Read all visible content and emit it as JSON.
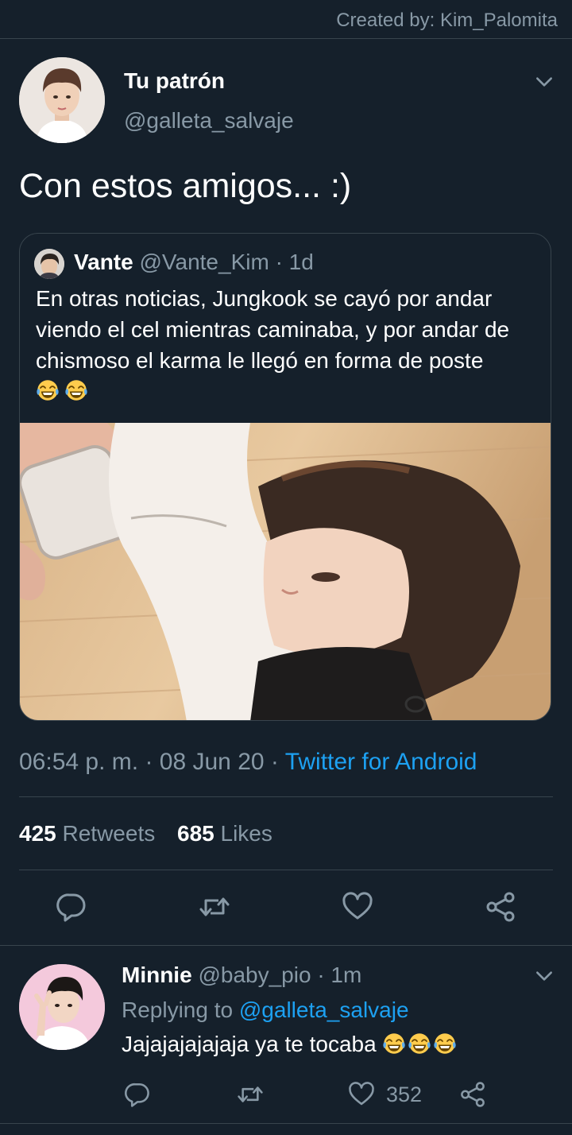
{
  "watermark": "Created by: Kim_Palomita",
  "tweet": {
    "display_name": "Tu patrón",
    "handle": "@galleta_salvaje",
    "text": "Con estos amigos... :)",
    "time": "06:54 p. m.",
    "date": "08 Jun 20",
    "sep": "·",
    "source": "Twitter for Android",
    "retweets_count": "425",
    "retweets_label": "Retweets",
    "likes_count": "685",
    "likes_label": "Likes"
  },
  "quoted": {
    "display_name": "Vante",
    "handle": "@Vante_Kim",
    "age": "· 1d",
    "text": "En otras noticias, Jungkook se cayó por andar viendo el cel mientras caminaba, y por andar de chismoso el karma le llegó en forma de poste",
    "emoji": [
      "face-with-tears-of-joy",
      "face-with-tears-of-joy"
    ]
  },
  "reply": {
    "display_name": "Minnie",
    "handle": "@baby_pio",
    "age": "· 1m",
    "replying_prefix": "Replying to",
    "replying_handle": "@galleta_salvaje",
    "text": "Jajajajajajaja ya te tocaba",
    "emoji": [
      "face-with-tears-of-joy",
      "face-with-tears-of-joy",
      "face-with-tears-of-joy"
    ],
    "likes_count": "352"
  },
  "icons": [
    "chevron-down-icon",
    "reply-icon",
    "retweet-icon",
    "like-icon",
    "share-icon"
  ],
  "colors": {
    "background": "#15202b",
    "divider": "#38444d",
    "muted": "#8899a6",
    "link": "#1da1f2"
  }
}
